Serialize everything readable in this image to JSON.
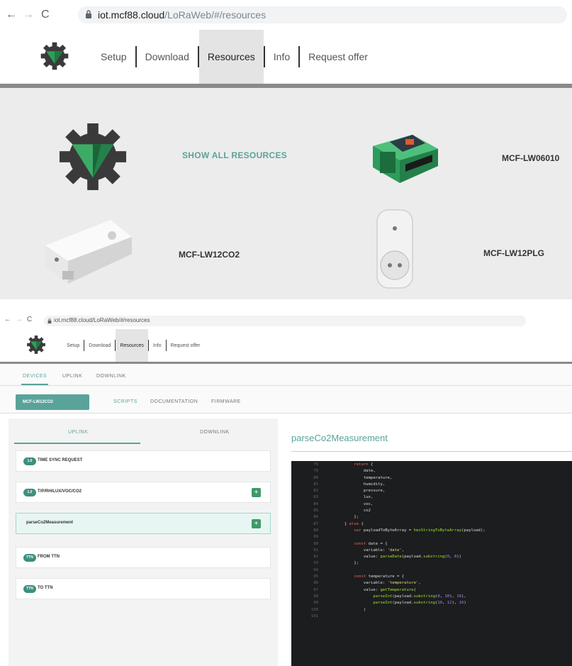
{
  "browser": {
    "url_host": "iot.mcf88.cloud",
    "url_path": "/LoRaWeb/#/resources",
    "url_host_small": "iot.mcf88.cloud",
    "url_path_small": "/LoRaWeb/#/resources"
  },
  "nav": {
    "items": [
      "Setup",
      "Download",
      "Resources",
      "Info",
      "Request offer"
    ],
    "active": "Resources"
  },
  "resources": {
    "show_all": "SHOW ALL RESOURCES",
    "devices": [
      "MCF-LW06010",
      "MCF-LW12CO2",
      "MCF-LW12PLG"
    ]
  },
  "detail": {
    "top_tabs": [
      "DEVICES",
      "UPLINK",
      "DOWNLINK"
    ],
    "device_button": "MCF-LW12CO2",
    "sub_tabs": [
      "SCRIPTS",
      "DOCUMENTATION",
      "FIRMWARE"
    ],
    "panel_tabs": [
      "UPLINK",
      "DOWNLINK"
    ],
    "scripts": [
      {
        "badge": "1.0",
        "label": "TIME SYNC REQUEST",
        "plus": false,
        "selected": false
      },
      {
        "badge": "1.0",
        "label": "T/P/RH/LUX/VOC/CO2",
        "plus": true,
        "selected": false
      },
      {
        "badge": "",
        "label": "parseCo2Measurement",
        "plus": true,
        "selected": true
      },
      {
        "badge": "TTN",
        "label": "FROM TTN",
        "plus": false,
        "selected": false
      },
      {
        "badge": "TTN",
        "label": "TO TTN",
        "plus": false,
        "selected": false
      }
    ],
    "function_title": "parseCo2Measurement",
    "plus_symbol": "+"
  },
  "code": {
    "line_numbers": "78\n79\n80\n81\n82\n83\n84\n85\n86\n87\n88\n89\n90\n91\n92\n93\n94\n95\n96\n97\n98\n99\n100\n101",
    "lines": [
      "            return {",
      "                date,",
      "                temperature,",
      "                humidity,",
      "                pressure,",
      "                lux,",
      "                voc,",
      "                co2",
      "            };",
      "        } else {",
      "            var payloadToByteArray = hexStringToByteArray(payload);",
      "",
      "            const date = {",
      "                variable: 'date',",
      "                value: parseDate(payload.substring(0, 8))",
      "            };",
      "",
      "            const temperature = {",
      "                variable: 'temperature',",
      "                value: getTemperature(",
      "                    parseInt(payload.substring(8, 10), 16),",
      "                    parseInt(payload.substring(10, 12), 16)",
      "                )",
      ""
    ]
  }
}
